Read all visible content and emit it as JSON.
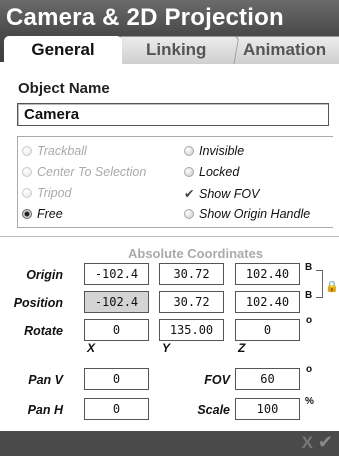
{
  "window": {
    "title": "Camera & 2D Projection"
  },
  "tabs": [
    {
      "label": "General"
    },
    {
      "label": "Linking"
    },
    {
      "label": "Animation"
    }
  ],
  "object": {
    "label": "Object Name",
    "value": "Camera"
  },
  "options": {
    "left": [
      {
        "label": "Trackball",
        "state": "disabled"
      },
      {
        "label": "Center To Selection",
        "state": "disabled"
      },
      {
        "label": "Tripod",
        "state": "disabled"
      },
      {
        "label": "Free",
        "state": "selected"
      }
    ],
    "right": [
      {
        "label": "Invisible",
        "state": "off"
      },
      {
        "label": "Locked",
        "state": "off"
      },
      {
        "label": "Show FOV",
        "state": "checked"
      },
      {
        "label": "Show Origin Handle",
        "state": "off"
      }
    ]
  },
  "coords": {
    "title": "Absolute Coordinates",
    "rows": [
      {
        "label": "Origin",
        "values": [
          "-102.4",
          "30.72",
          "102.40"
        ],
        "unit": "B"
      },
      {
        "label": "Position",
        "values": [
          "-102.4",
          "30.72",
          "102.40"
        ],
        "unit": "B"
      },
      {
        "label": "Rotate",
        "values": [
          "0",
          "135.00",
          "0"
        ],
        "unit": "o"
      }
    ],
    "axes": [
      "X",
      "Y",
      "Z"
    ]
  },
  "pan": {
    "pan_v": {
      "label": "Pan V",
      "value": "0"
    },
    "pan_h": {
      "label": "Pan H",
      "value": "0"
    },
    "fov": {
      "label": "FOV",
      "value": "60",
      "unit": "o"
    },
    "scale": {
      "label": "Scale",
      "value": "100",
      "unit": "%"
    }
  },
  "footer": {
    "cancel": "X",
    "ok": "✔"
  },
  "colors": {
    "header": "#4a4a4a",
    "footer": "#4a4a4a",
    "field_border": "#555555"
  }
}
